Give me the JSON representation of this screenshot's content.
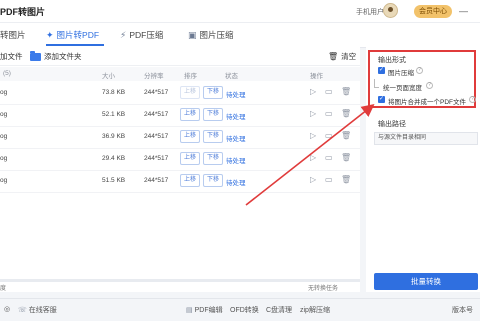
{
  "titlebar": {
    "app_title": "PDF转图片",
    "user_label": "手机用户",
    "vip_label": "会员中心",
    "minimize_glyph": "—"
  },
  "tabs": [
    {
      "label": "转图片",
      "icon": "image-icon"
    },
    {
      "label": "图片转PDF",
      "icon": "pdf-icon",
      "active": true
    },
    {
      "label": "PDF压缩",
      "icon": "compress-icon"
    },
    {
      "label": "图片压缩",
      "icon": "image-compress-icon"
    }
  ],
  "toolbar": {
    "add_file": "加文件",
    "add_folder": "添加文件夹",
    "clear": "清空"
  },
  "table": {
    "headers": {
      "name": "(5)",
      "size": "大小",
      "resolution": "分辨率",
      "sort": "排序",
      "status": "状态",
      "ops": "操作"
    },
    "rows": [
      {
        "name": "og",
        "size": "73.8 KB",
        "resolution": "244*517",
        "up": "上移",
        "down": "下移",
        "status": "待处理",
        "up_disabled": true
      },
      {
        "name": "og",
        "size": "52.1 KB",
        "resolution": "244*517",
        "up": "上移",
        "down": "下移",
        "status": "待处理"
      },
      {
        "name": "og",
        "size": "36.9 KB",
        "resolution": "244*517",
        "up": "上移",
        "down": "下移",
        "status": "待处理"
      },
      {
        "name": "og",
        "size": "29.4 KB",
        "resolution": "244*517",
        "up": "上移",
        "down": "下移",
        "status": "待处理"
      },
      {
        "name": "og",
        "size": "51.5 KB",
        "resolution": "244*517",
        "up": "上移",
        "down": "下移",
        "status": "待处理"
      }
    ]
  },
  "progress": {
    "left_label": "度",
    "right_label": "无转换任务"
  },
  "output_settings": {
    "format_title": "输出形式",
    "compress_label": "图片压缩",
    "page_width_label": "统一页面宽度",
    "merge_label": "将图片合并成一个PDF文件",
    "path_title": "输出路径",
    "path_value": "与源文件目录相同",
    "convert_button": "批量转换"
  },
  "bottom": {
    "support": "在线客服",
    "pdf_edit": "PDF编辑",
    "ofd": "OFD转换",
    "disk": "C盘清理",
    "zip": "zip解压缩",
    "right_text": "版本号"
  },
  "colors": {
    "accent": "#2f6fe0",
    "annotation": "#e03b3b",
    "vip": "#f2c26a"
  }
}
